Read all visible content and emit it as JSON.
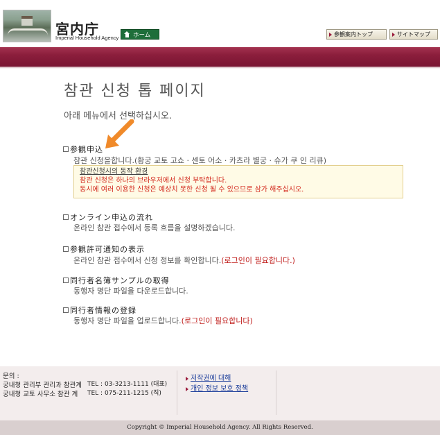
{
  "header": {
    "logo_title": "宮内庁",
    "logo_subtitle": "Imperial Household Agency",
    "home_label": "ホーム",
    "guide_top_label": "参観案内トップ",
    "sitemap_label": "サイトマップ"
  },
  "main": {
    "title": "참관 신청 톱 페이지",
    "intro": "아래 메뉴에서 선택하십시오.",
    "menu": [
      {
        "heading": "参観申込",
        "desc": "참관 신청을합니다.(황궁 교토 고쇼 · 센토 어소 · 카츠라 별궁 · 슈가 쿠 인 리큐)",
        "note": ""
      },
      {
        "heading": "オンライン申込の流れ",
        "desc": "온라인 참관 접수에서 등록 흐름을 설명하겠습니다.",
        "note": ""
      },
      {
        "heading": "参観許可通知の表示",
        "desc": "온라인 참관 접수에서 신청 정보를 확인합니다.",
        "note": "(로그인이 필요합니다.)"
      },
      {
        "heading": "同行者名簿サンプルの取得",
        "desc": "동행자 명단 파일을 다운로드합니다.",
        "note": ""
      },
      {
        "heading": "同行者情報の登録",
        "desc": "동행자 명단 파일을 업로드합니다.",
        "note": "(로그인이 필요합니다)"
      }
    ],
    "notice": {
      "title": "참관신청시의 동작 환경",
      "line1": "참관 신청은 하나의 브라우저에서 신청 부탁합니다.",
      "line2": "동시에 여러 이용한 신청은 예상치 못한 신청 될 수 있으므로 삼가 해주십시오."
    }
  },
  "footer": {
    "contact_label": "문의 :",
    "contact_office1": "궁내청 관리부 관리과 참관계",
    "contact_office2": "궁내청 교토 사무소 참관 계",
    "tel1": "TEL : 03-3213-1111 (대표)",
    "tel2": "TEL : 075-211-1215 (직)",
    "link_copyright": "저작권에 대해",
    "link_privacy": "개인 정보 보호 정책",
    "copyright": "Copyright © Imperial Household Agency. All Rights Reserved."
  },
  "colors": {
    "band": "#8b1e3c",
    "home_button": "#1e6e3a",
    "required_text": "#c0201e",
    "arrow": "#f08a2a"
  }
}
